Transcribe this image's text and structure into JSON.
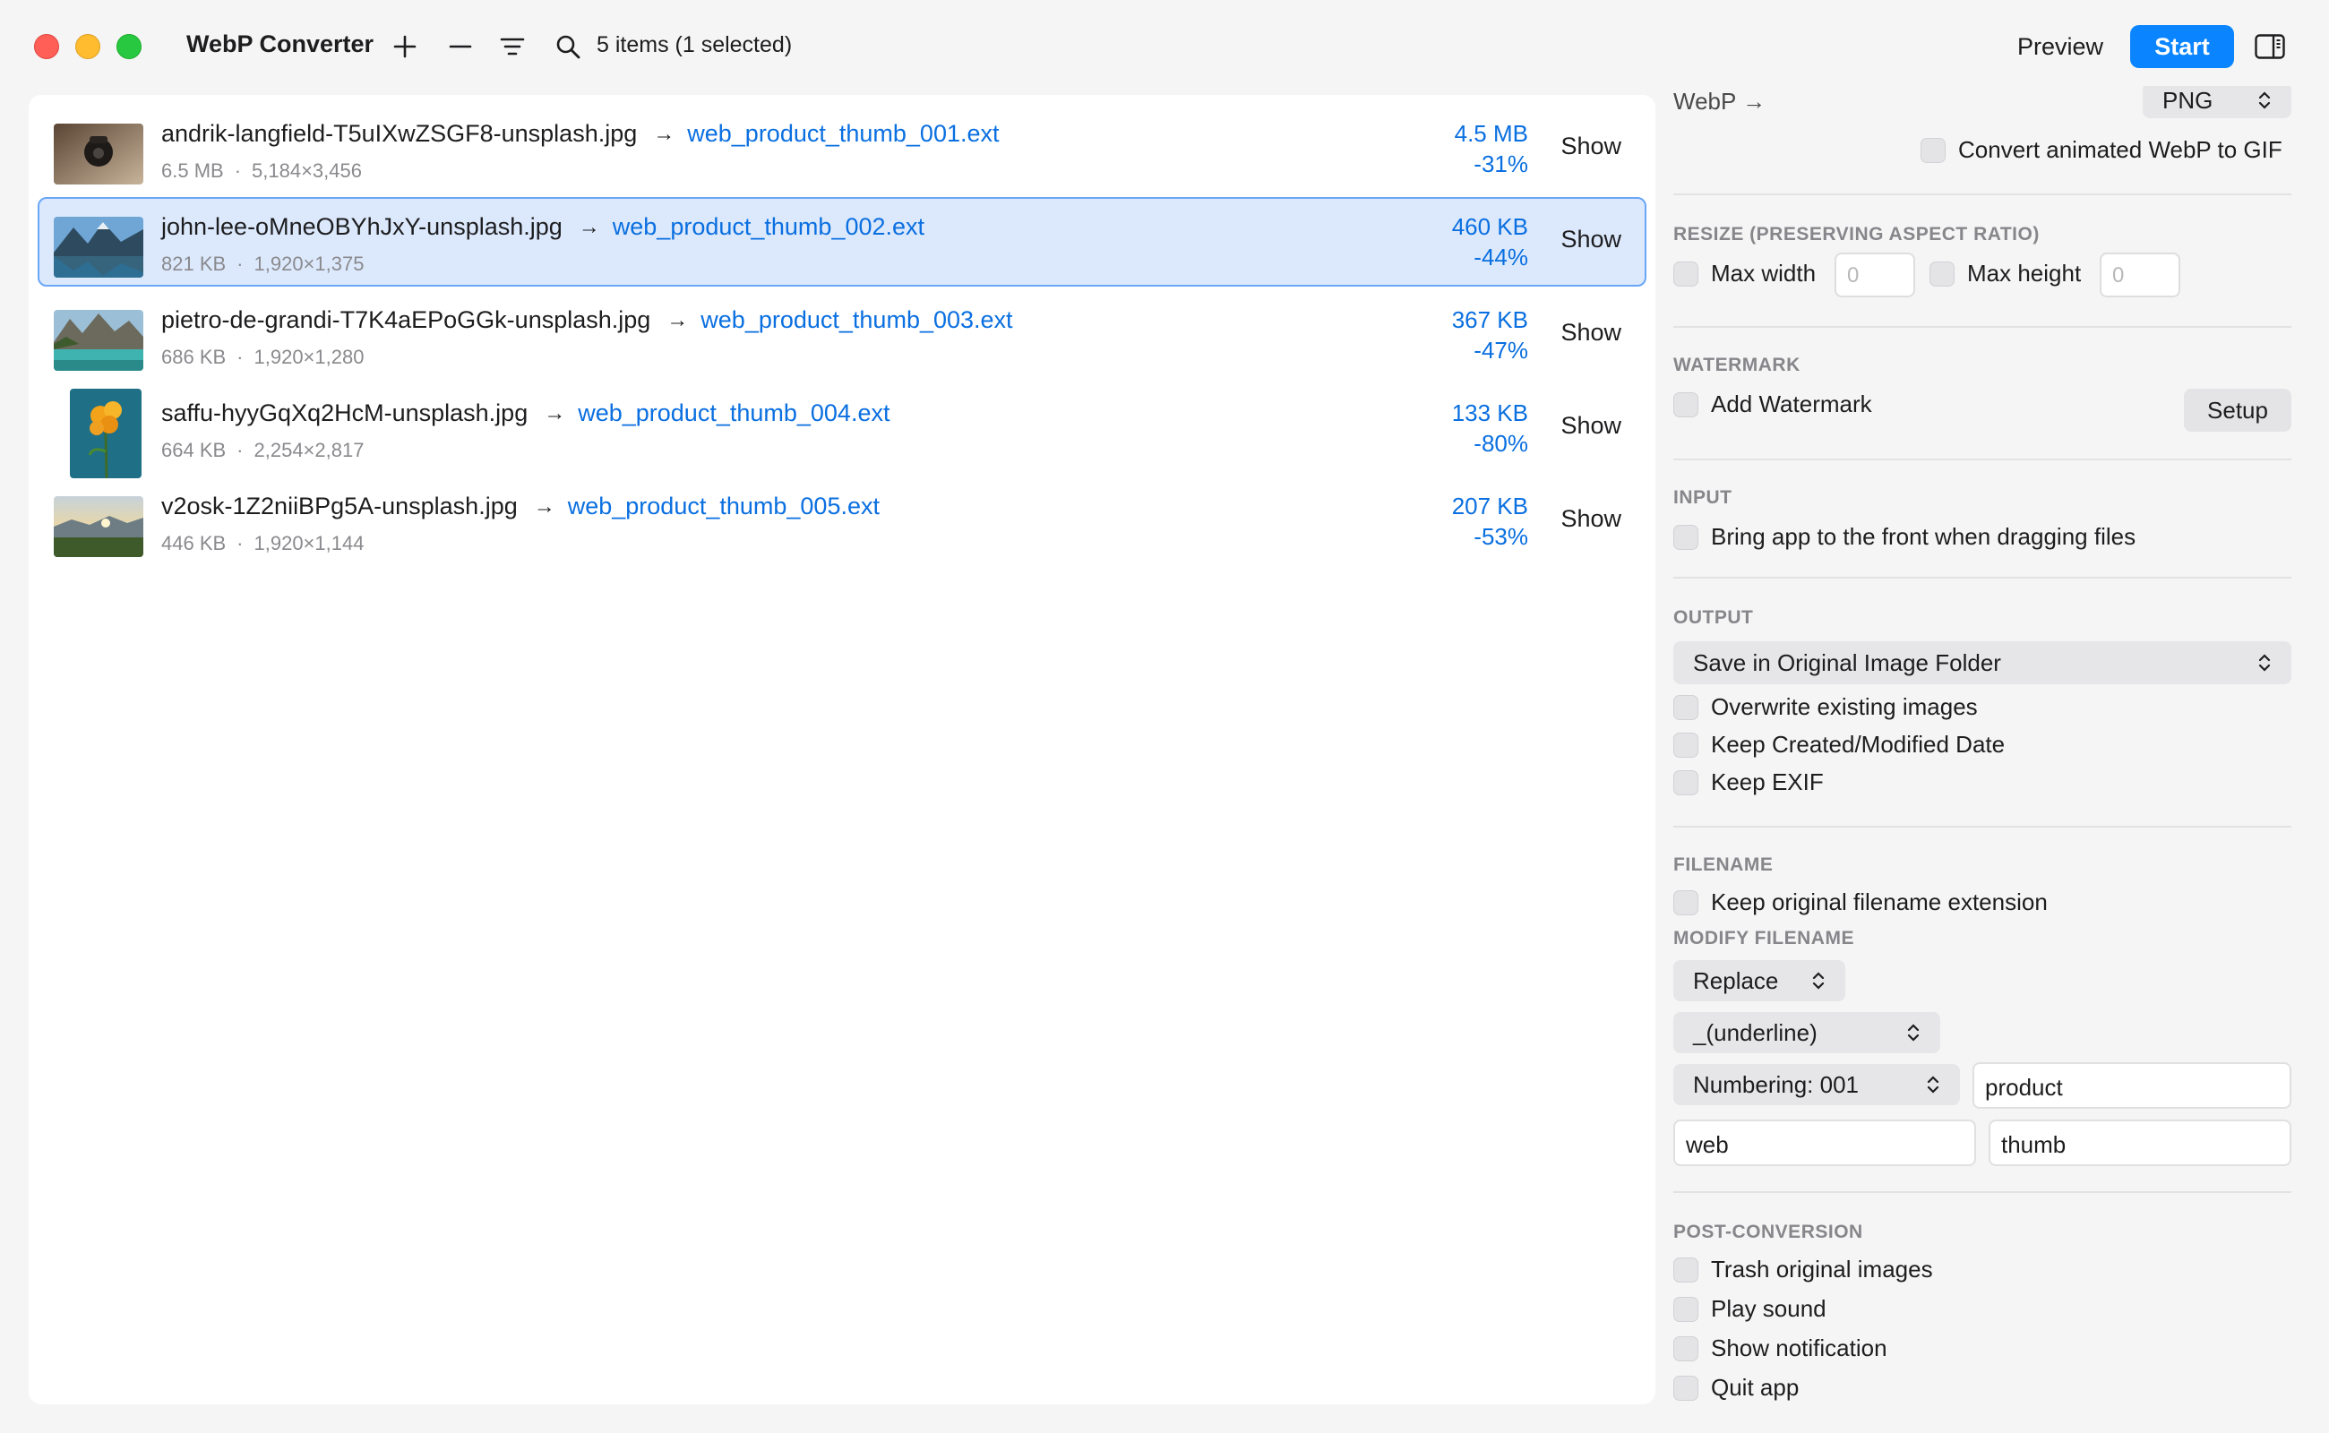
{
  "window": {
    "app_title": "WebP Converter",
    "items_count": "5 items (1 selected)",
    "preview_label": "Preview",
    "start_label": "Start",
    "accent_color": "#0a84ff",
    "link_color": "#0a6fe0"
  },
  "files": [
    {
      "name": "andrik-langfield-T5uIXwZSGF8-unsplash.jpg",
      "output": "web_product_thumb_001.ext",
      "size": "6.5 MB",
      "dims": "5,184×3,456",
      "new_size": "4.5 MB",
      "reduction": "-31%",
      "action": "Show",
      "selected": false
    },
    {
      "name": "john-lee-oMneOBYhJxY-unsplash.jpg",
      "output": "web_product_thumb_002.ext",
      "size": "821 KB",
      "dims": "1,920×1,375",
      "new_size": "460 KB",
      "reduction": "-44%",
      "action": "Show",
      "selected": true
    },
    {
      "name": "pietro-de-grandi-T7K4aEPoGGk-unsplash.jpg",
      "output": "web_product_thumb_003.ext",
      "size": "686 KB",
      "dims": "1,920×1,280",
      "new_size": "367 KB",
      "reduction": "-47%",
      "action": "Show",
      "selected": false
    },
    {
      "name": "saffu-hyyGqXq2HcM-unsplash.jpg",
      "output": "web_product_thumb_004.ext",
      "size": "664 KB",
      "dims": "2,254×2,817",
      "new_size": "133 KB",
      "reduction": "-80%",
      "action": "Show",
      "selected": false
    },
    {
      "name": "v2osk-1Z2niiBPg5A-unsplash.jpg",
      "output": "web_product_thumb_005.ext",
      "size": "446 KB",
      "dims": "1,920×1,144",
      "new_size": "207 KB",
      "reduction": "-53%",
      "action": "Show",
      "selected": false
    }
  ],
  "settings": {
    "format": {
      "from_label": "WebP →",
      "target": "PNG",
      "animated_label": "Convert animated WebP to GIF"
    },
    "resize": {
      "title": "RESIZE (PRESERVING ASPECT RATIO)",
      "max_width_label": "Max width",
      "max_width_placeholder": "0",
      "max_height_label": "Max height",
      "max_height_placeholder": "0"
    },
    "watermark": {
      "title": "WATERMARK",
      "add_label": "Add Watermark",
      "setup_label": "Setup"
    },
    "input": {
      "title": "INPUT",
      "bring_front_label": "Bring app to the front when dragging files"
    },
    "output": {
      "title": "OUTPUT",
      "location": "Save in Original Image Folder",
      "overwrite_label": "Overwrite existing images",
      "keep_date_label": "Keep Created/Modified Date",
      "keep_exif_label": "Keep EXIF"
    },
    "filename": {
      "title": "FILENAME",
      "keep_ext_label": "Keep original filename extension",
      "modify_title": "MODIFY FILENAME",
      "mode": "Replace",
      "separator": "_(underline)",
      "numbering": "Numbering: 001",
      "field_product": "product",
      "field_web": "web",
      "field_thumb": "thumb"
    },
    "post": {
      "title": "POST-CONVERSION",
      "trash_label": "Trash original images",
      "sound_label": "Play sound",
      "notify_label": "Show notification",
      "quit_label": "Quit app"
    }
  }
}
